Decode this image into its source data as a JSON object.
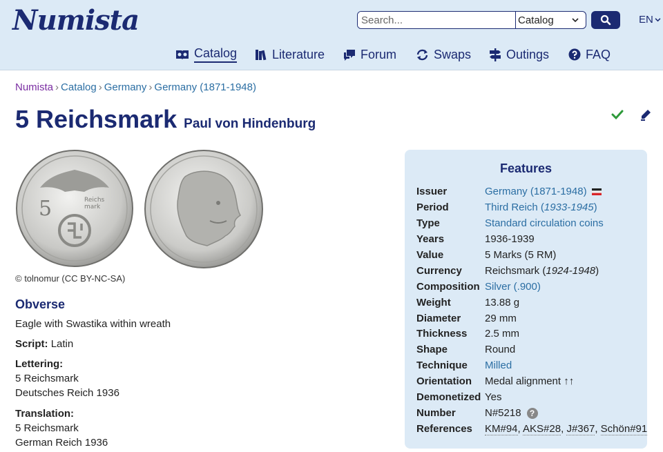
{
  "brand": "Numista",
  "search": {
    "placeholder": "Search...",
    "scope": "Catalog"
  },
  "language": "EN",
  "nav": [
    {
      "label": "Catalog",
      "icon": "catalog-icon"
    },
    {
      "label": "Literature",
      "icon": "books-icon"
    },
    {
      "label": "Forum",
      "icon": "chat-icon"
    },
    {
      "label": "Swaps",
      "icon": "swap-icon"
    },
    {
      "label": "Outings",
      "icon": "signpost-icon"
    },
    {
      "label": "FAQ",
      "icon": "help-icon"
    }
  ],
  "breadcrumb": [
    "Numista",
    "Catalog",
    "Germany",
    "Germany (1871-1948)"
  ],
  "title": {
    "main": "5 Reichsmark",
    "sub": "Paul von Hindenburg"
  },
  "image_credit": "© tolnomur (CC BY-NC-SA)",
  "obverse": {
    "heading": "Obverse",
    "description": "Eagle with Swastika within wreath",
    "script_label": "Script:",
    "script_value": "Latin",
    "lettering_label": "Lettering:",
    "lettering_lines": [
      "5 Reichsmark",
      "Deutsches Reich 1936"
    ],
    "translation_label": "Translation:",
    "translation_lines": [
      "5 Reichsmark",
      "German Reich 1936"
    ]
  },
  "features": {
    "heading": "Features",
    "issuer_label": "Issuer",
    "issuer_value": "Germany (1871-1948)",
    "period_label": "Period",
    "period_value": "Third Reich",
    "period_years": "1933-1945",
    "type_label": "Type",
    "type_value": "Standard circulation coins",
    "years_label": "Years",
    "years_value": "1936-1939",
    "value_label": "Value",
    "value_value": "5 Marks (5 RM)",
    "currency_label": "Currency",
    "currency_value": "Reichsmark",
    "currency_years": "1924-1948",
    "composition_label": "Composition",
    "composition_value": "Silver (.900)",
    "weight_label": "Weight",
    "weight_value": "13.88 g",
    "diameter_label": "Diameter",
    "diameter_value": "29 mm",
    "thickness_label": "Thickness",
    "thickness_value": "2.5 mm",
    "shape_label": "Shape",
    "shape_value": "Round",
    "technique_label": "Technique",
    "technique_value": "Milled",
    "orientation_label": "Orientation",
    "orientation_value": "Medal alignment ↑↑",
    "demonetized_label": "Demonetized",
    "demonetized_value": "Yes",
    "number_label": "Number",
    "number_value": "N#5218",
    "references_label": "References",
    "references": [
      "KM#94",
      "AKS#28",
      "J#367",
      "Schön#91"
    ]
  },
  "colors": {
    "brand": "#1b2a72",
    "link": "#2b6ea3",
    "header_bg": "#dceaf6",
    "check": "#2e9a3a"
  }
}
